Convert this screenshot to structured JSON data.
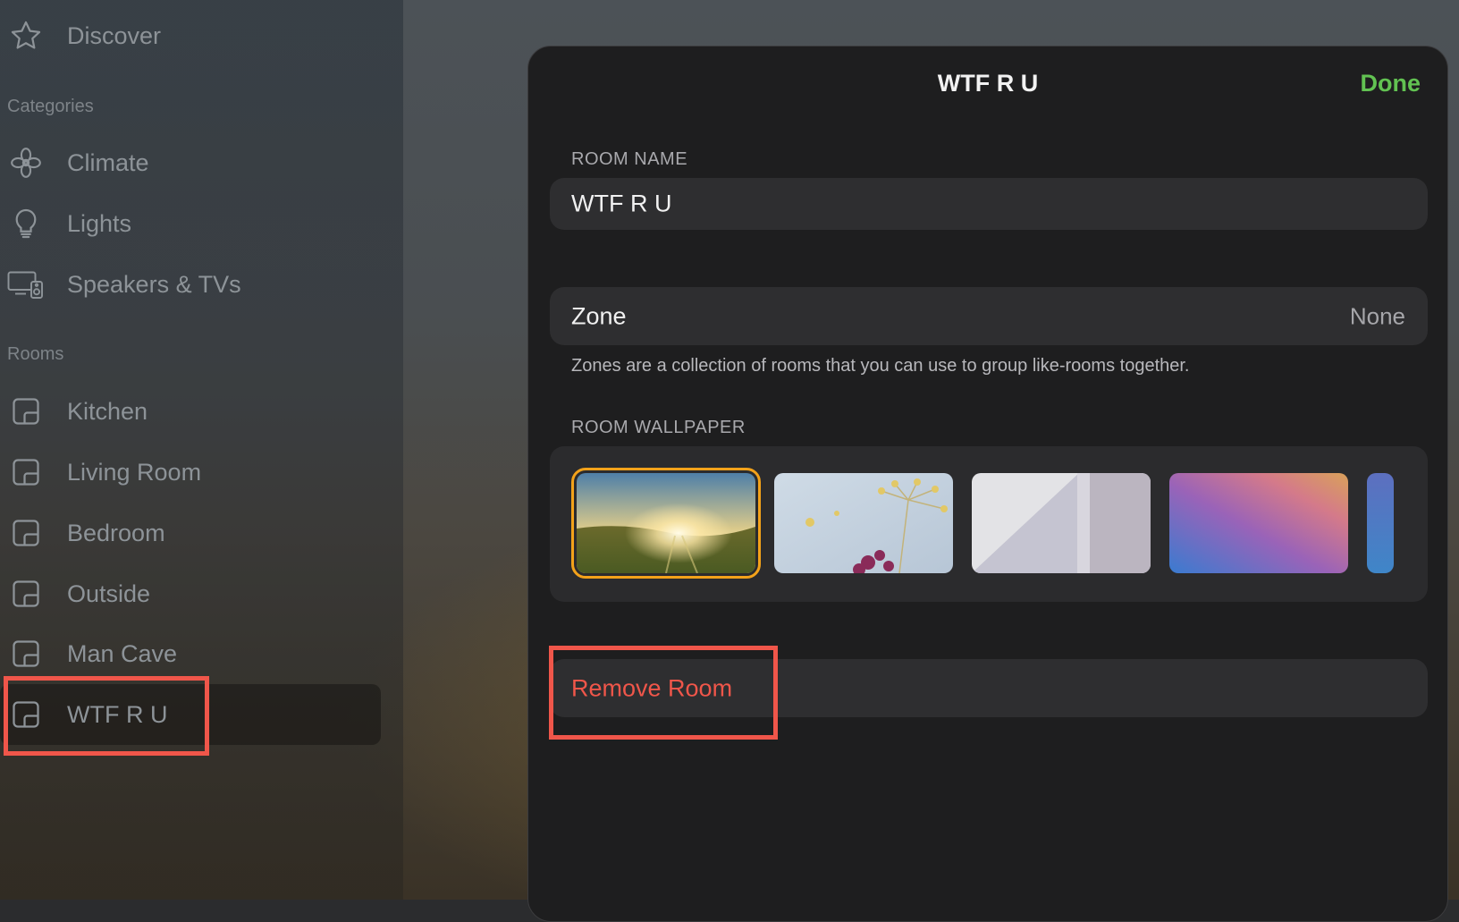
{
  "sidebar": {
    "discover": {
      "label": "Discover",
      "icon": "star-icon"
    },
    "categories_title": "Categories",
    "categories": [
      {
        "label": "Climate",
        "icon": "fan-icon"
      },
      {
        "label": "Lights",
        "icon": "lightbulb-icon"
      },
      {
        "label": "Speakers & TVs",
        "icon": "speaker-tv-icon"
      }
    ],
    "rooms_title": "Rooms",
    "rooms": [
      {
        "label": "Kitchen",
        "icon": "room-icon"
      },
      {
        "label": "Living Room",
        "icon": "room-icon"
      },
      {
        "label": "Bedroom",
        "icon": "room-icon"
      },
      {
        "label": "Outside",
        "icon": "room-icon"
      },
      {
        "label": "Man Cave",
        "icon": "room-icon"
      },
      {
        "label": "WTF R U",
        "icon": "room-icon",
        "selected": true
      }
    ]
  },
  "sheet": {
    "title": "WTF R U",
    "done_label": "Done",
    "room_name_label": "ROOM NAME",
    "room_name_value": "WTF R U",
    "zone_label": "Zone",
    "zone_value": "None",
    "zone_help": "Zones are a collection of rooms that you can use to group like-rooms together.",
    "wallpaper_label": "ROOM WALLPAPER",
    "wallpapers": [
      "sunset-field",
      "fennel-flowers",
      "white-wall",
      "color-gradient",
      "blue-gradient"
    ],
    "selected_wallpaper": "sunset-field",
    "remove_label": "Remove Room"
  },
  "colors": {
    "accent_done": "#62c252",
    "destructive": "#f0564a",
    "selection_outline": "#f3a21a",
    "annotation_box": "#f0564a"
  }
}
